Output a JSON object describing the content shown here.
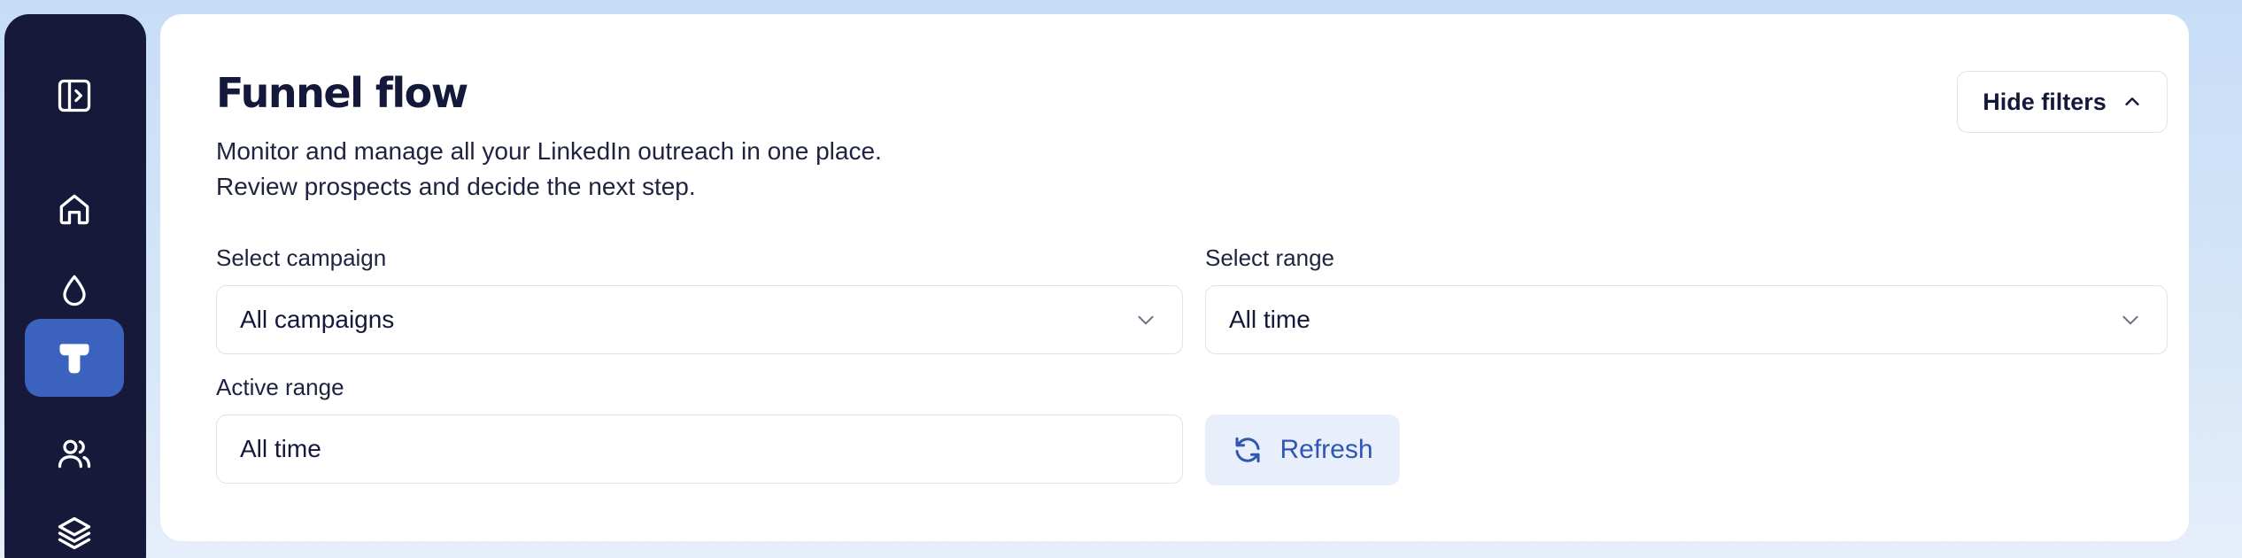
{
  "sidebar": {
    "items": [
      {
        "id": "toggle",
        "icon": "sidebar-toggle-icon",
        "active": false
      },
      {
        "id": "home",
        "icon": "home-icon",
        "active": false
      },
      {
        "id": "drop",
        "icon": "droplet-icon",
        "active": false
      },
      {
        "id": "funnel",
        "icon": "funnel-icon",
        "active": true
      },
      {
        "id": "users",
        "icon": "users-icon",
        "active": false
      },
      {
        "id": "layers",
        "icon": "layers-icon",
        "active": false
      }
    ]
  },
  "header": {
    "title": "Funnel flow",
    "subtitle_line1": "Monitor and manage all your LinkedIn outreach in one place.",
    "subtitle_line2": "Review prospects and decide the next step.",
    "hide_filters_label": "Hide filters"
  },
  "filters": {
    "campaign_label": "Select campaign",
    "campaign_value": "All campaigns",
    "range_label": "Select range",
    "range_value": "All time",
    "active_range_label": "Active range",
    "active_range_value": "All time",
    "refresh_label": "Refresh"
  },
  "colors": {
    "sidebar_bg": "#16193a",
    "accent": "#3b63bd",
    "refresh_bg": "#e9eefb",
    "refresh_text": "#2f56b3"
  }
}
